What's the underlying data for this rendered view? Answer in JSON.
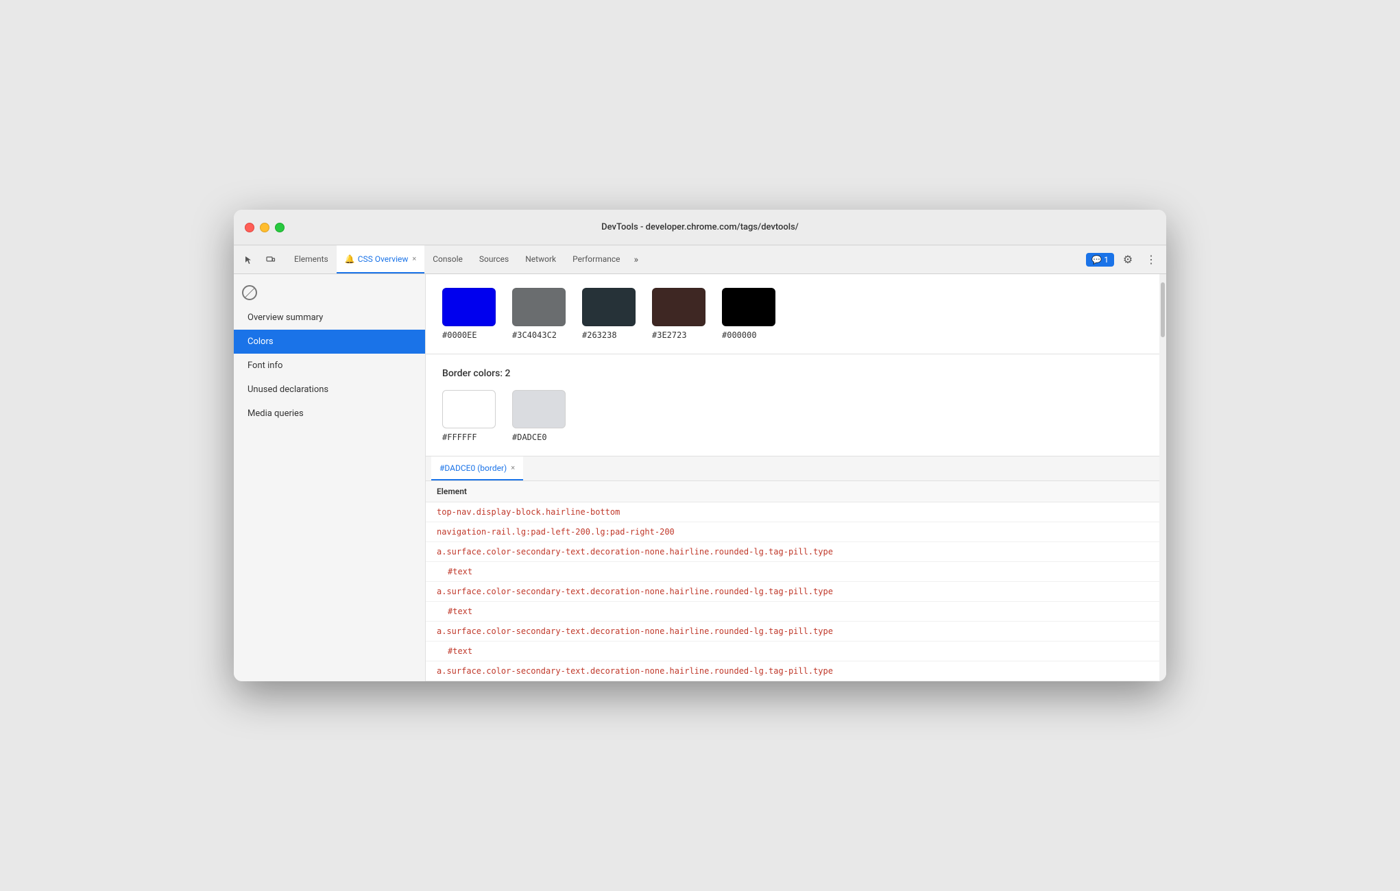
{
  "window": {
    "title": "DevTools - developer.chrome.com/tags/devtools/"
  },
  "tabs": {
    "items": [
      {
        "id": "elements",
        "label": "Elements",
        "active": false,
        "closable": false
      },
      {
        "id": "css-overview",
        "label": "CSS Overview",
        "active": true,
        "closable": true,
        "icon": "🔔"
      },
      {
        "id": "console",
        "label": "Console",
        "active": false,
        "closable": false
      },
      {
        "id": "sources",
        "label": "Sources",
        "active": false,
        "closable": false
      },
      {
        "id": "network",
        "label": "Network",
        "active": false,
        "closable": false
      },
      {
        "id": "performance",
        "label": "Performance",
        "active": false,
        "closable": false
      }
    ],
    "more_label": "»",
    "chat_badge": "💬 1",
    "settings_icon": "⚙",
    "more_icon": "⋮"
  },
  "sidebar": {
    "items": [
      {
        "id": "overview-summary",
        "label": "Overview summary",
        "active": false
      },
      {
        "id": "colors",
        "label": "Colors",
        "active": true
      },
      {
        "id": "font-info",
        "label": "Font info",
        "active": false
      },
      {
        "id": "unused-declarations",
        "label": "Unused declarations",
        "active": false
      },
      {
        "id": "media-queries",
        "label": "Media queries",
        "active": false
      }
    ]
  },
  "colors": {
    "top_swatches": [
      {
        "hex": "#0000EE",
        "color": "#0000EE"
      },
      {
        "hex": "#3C4043C2",
        "color": "#3C4043"
      },
      {
        "hex": "#263238",
        "color": "#263238"
      },
      {
        "hex": "#3E2723",
        "color": "#3E2723"
      },
      {
        "hex": "#000000",
        "color": "#000000"
      }
    ],
    "border_title": "Border colors: 2",
    "border_swatches": [
      {
        "hex": "#FFFFFF",
        "color": "#FFFFFF"
      },
      {
        "hex": "#DADCE0",
        "color": "#DADCE0"
      }
    ]
  },
  "element_panel": {
    "tab_label": "#DADCE0 (border)",
    "tab_close": "×",
    "table_header": "Element",
    "rows": [
      {
        "type": "selector",
        "text": "top-nav.display-block.hairline-bottom"
      },
      {
        "type": "selector",
        "text": "navigation-rail.lg:pad-left-200.lg:pad-right-200"
      },
      {
        "type": "selector",
        "text": "a.surface.color-secondary-text.decoration-none.hairline.rounded-lg.tag-pill.type"
      },
      {
        "type": "text",
        "text": "#text"
      },
      {
        "type": "selector",
        "text": "a.surface.color-secondary-text.decoration-none.hairline.rounded-lg.tag-pill.type"
      },
      {
        "type": "text",
        "text": "#text"
      },
      {
        "type": "selector",
        "text": "a.surface.color-secondary-text.decoration-none.hairline.rounded-lg.tag-pill.type"
      },
      {
        "type": "text",
        "text": "#text"
      },
      {
        "type": "selector",
        "text": "a.surface.color-secondary-text.decoration-none.hairline.rounded-lg.tag-pill.type"
      }
    ]
  }
}
